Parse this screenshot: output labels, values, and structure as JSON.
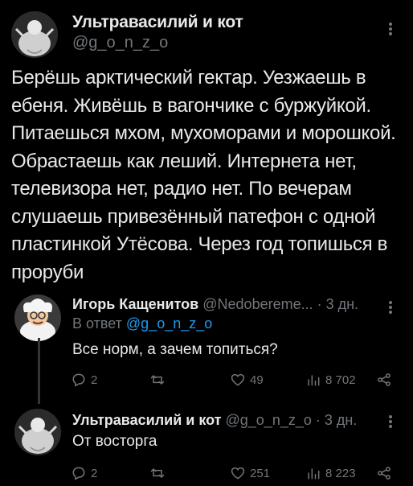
{
  "main_tweet": {
    "author_name": "Ультравасилий и кот",
    "handle": "@g_o_n_z_o",
    "text": "Берёшь арктический гектар. Уезжаешь в ебеня. Живёшь в вагончике с буржуйкой. Питаешься мхом, мухоморами и морошкой. Обрастаешь как леший. Интернета нет, телевизора нет, радио нет. По вечерам слушаешь привезённый патефон с одной пластинкой Утёсова. Через год топишься в проруби"
  },
  "reply_1": {
    "author_name": "Игорь Кащенитов",
    "meta": "@Nedobereme... · 3 дн.",
    "reply_prefix": "В ответ",
    "reply_to": "@g_o_n_z_o",
    "text": "Все норм, а зачем топиться?",
    "replies": "2",
    "retweets": "",
    "likes": "49",
    "views": "8 702"
  },
  "reply_2": {
    "author_name": "Ультравасилий и кот",
    "meta": "@g_o_n_z_o · 3 дн.",
    "text": "От восторга",
    "replies": "2",
    "retweets": "",
    "likes": "251",
    "views": "8 223"
  },
  "icons": {
    "reply": "comment-icon",
    "retweet": "retweet-icon",
    "like": "heart-icon",
    "views": "views-chart-icon",
    "share": "share-icon",
    "more": "more-vertical-icon"
  }
}
